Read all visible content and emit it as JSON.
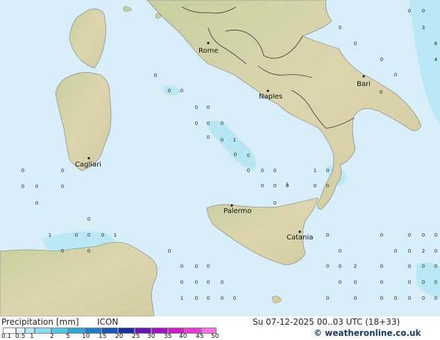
{
  "map": {
    "cities": [
      {
        "name": "Rome"
      },
      {
        "name": "Naples"
      },
      {
        "name": "Bari"
      },
      {
        "name": "Cagliari"
      },
      {
        "name": "Palermo"
      },
      {
        "name": "Catania"
      }
    ],
    "values": [
      "0",
      "0",
      "0",
      "0",
      "0",
      "0",
      "0",
      "0",
      "0",
      "0",
      "1",
      "0",
      "0",
      "0",
      "0",
      "0",
      "1",
      "0",
      "0",
      "0",
      "0",
      "0",
      "0",
      "0",
      "0",
      "0",
      "0",
      "0",
      "0",
      "0",
      "0",
      "0",
      "0",
      "0",
      "0",
      "1",
      "0",
      "0",
      "0",
      "1",
      "0",
      "0",
      "0",
      "0",
      "0",
      "0",
      "0",
      "0",
      "0",
      "0",
      "0",
      "1",
      "0",
      "0",
      "0",
      "0",
      "1",
      "0",
      "0",
      "0",
      "0",
      "0",
      "2",
      "2",
      "0",
      "0",
      "0",
      "0",
      "0",
      "0",
      "0",
      "0",
      "0",
      "0",
      "0",
      "0",
      "0",
      "0",
      "0",
      "0",
      "0",
      "0",
      "0",
      "0",
      "0",
      "0",
      "0",
      "3",
      "6",
      "4",
      "0",
      "0"
    ],
    "colors": {
      "sea": "#d8eef8",
      "land": "#dcd7b0",
      "light_precip": "#a8e4f2",
      "border": "#333333"
    }
  },
  "footer": {
    "title": "Precipitation [mm]",
    "model": "ICON",
    "datetime": "Su 07-12-2025 00..03 UTC (18+33)",
    "copyright": "© weatheronline.co.uk"
  },
  "legend": {
    "ticks": [
      "0.1",
      "0.5",
      "1",
      "2",
      "5",
      "10",
      "15",
      "20",
      "25",
      "30",
      "35",
      "40",
      "45",
      "50"
    ],
    "colors": [
      "#ffffff",
      "#d8f4fb",
      "#aeeaf6",
      "#84dcf0",
      "#52c6e8",
      "#2aa8dc",
      "#1c7ccc",
      "#1854b8",
      "#1830a0",
      "#6a14b4",
      "#a014c4",
      "#d018c8",
      "#e838d8",
      "#f870e8"
    ]
  }
}
